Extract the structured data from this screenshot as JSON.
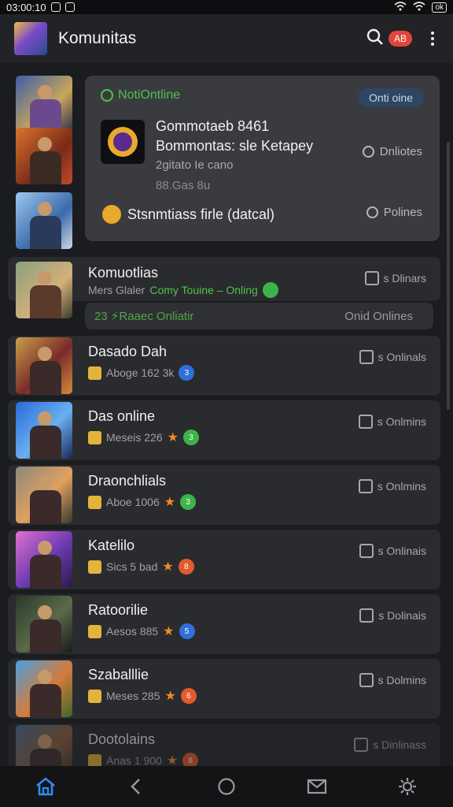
{
  "status_bar": {
    "time": "03:00:10",
    "battery": "ok"
  },
  "header": {
    "title": "Komunitas",
    "notification_count": "AB"
  },
  "featured": {
    "status": "NotiOntline",
    "pill": "Onti oine",
    "line1": "Gommotaeb 8461",
    "line2": "Bommontas: sle Ketapey",
    "line3": "2gitato Ie cano",
    "line4": "88.Gas 8u",
    "side1": "Dnliotes",
    "bottom": "Stsnmtiass firle (datcal)",
    "side2": "Polines"
  },
  "community_row": {
    "name": "Komuotlias",
    "meta_prefix": "Mers Glaler",
    "meta_highlight": "Comy Touine – Onling",
    "online": "s Dlinars"
  },
  "sub_bar": {
    "left": "23 ⚡Raaec Onliatir",
    "right": "Onid Onlines"
  },
  "rows": [
    {
      "name": "Dasado Dah",
      "meta": "Aboge 162 3k",
      "online": "s Onlinals",
      "accent": "#2f6fd8",
      "badge": "3"
    },
    {
      "name": "Das online",
      "meta": "Meseis 226",
      "online": "s Onlmins",
      "accent": "#3bb54a",
      "badge": "3"
    },
    {
      "name": "Draonchlials",
      "meta": "Aboe 1006",
      "online": "s Onlmins",
      "accent": "#3bb54a",
      "badge": "3"
    },
    {
      "name": "Katelilo",
      "meta": "Sics 5 bad",
      "online": "s Onlinais",
      "accent": "#e45a2c",
      "badge": "8"
    },
    {
      "name": "Ratoorilie",
      "meta": "Aesos 885",
      "online": "s Dolinais",
      "accent": "#2f6fd8",
      "badge": "5"
    },
    {
      "name": "Szaballlie",
      "meta": "Meses 285",
      "online": "s Dolmins",
      "accent": "#e45a2c",
      "badge": "6"
    },
    {
      "name": "Dootolains",
      "meta": "Anas 1 900",
      "online": "s Dinlinass",
      "accent": "#e45a2c",
      "badge": "8"
    }
  ]
}
